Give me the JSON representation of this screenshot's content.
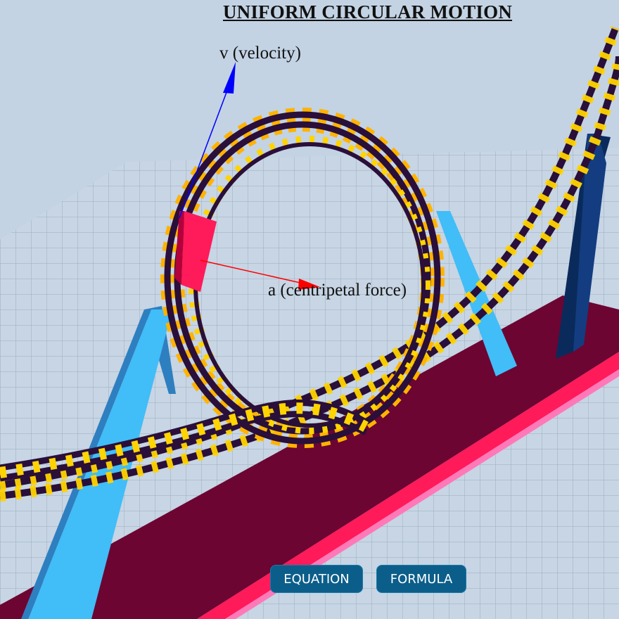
{
  "title": "UNIFORM CIRCULAR MOTION",
  "labels": {
    "velocity": "v (velocity)",
    "acceleration": "a (centripetal force)"
  },
  "buttons": {
    "equation": "EQUATION",
    "formula": "FORMULA"
  },
  "colors": {
    "sky": "#c3d3e4",
    "track": "#2a0f3a",
    "ties": "#ffc400",
    "support": "#41bdf7",
    "base": "#6c0532",
    "velocity_vector": "#0000ff",
    "acceleration_vector": "#ff0000",
    "button": "#0b5e8a"
  }
}
